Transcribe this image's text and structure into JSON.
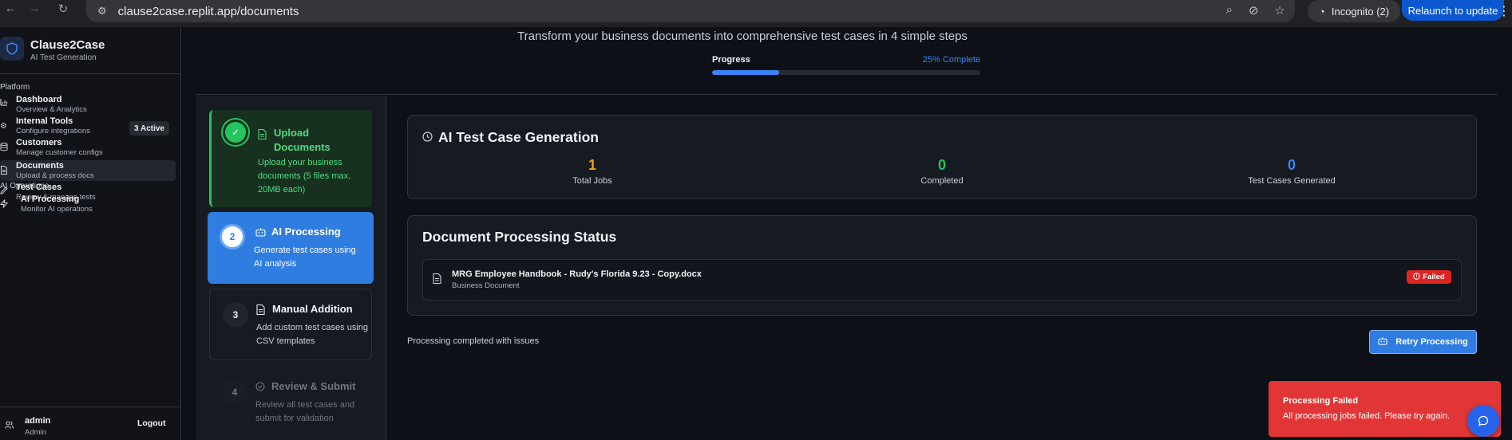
{
  "browser": {
    "url": "clause2case.replit.app/documents",
    "incognito_label": "Incognito (2)",
    "relaunch_label": "Relaunch to update"
  },
  "sidebar": {
    "brand_title": "Clause2Case",
    "brand_subtitle": "AI Test Generation",
    "section_platform": "Platform",
    "section_ai_ops": "AI Operations",
    "items": [
      {
        "title": "Dashboard",
        "subtitle": "Overview & Analytics",
        "icon": "bar-chart-icon"
      },
      {
        "title": "Internal Tools",
        "subtitle": "Configure integrations",
        "icon": "gear-icon",
        "badge": "3 Active"
      },
      {
        "title": "Customers",
        "subtitle": "Manage customer configs",
        "icon": "database-icon"
      },
      {
        "title": "Documents",
        "subtitle": "Upload & process docs",
        "icon": "file-icon",
        "active": true
      },
      {
        "title": "Test Cases",
        "subtitle": "Review & manage tests",
        "icon": "pencil-icon"
      }
    ],
    "ai_items": [
      {
        "title": "AI Processing",
        "subtitle": "Monitor AI operations",
        "icon": "bolt-icon"
      }
    ],
    "user": {
      "name": "admin",
      "role": "Admin"
    },
    "logout_label": "Logout"
  },
  "header": {
    "subtitle": "Transform your business documents into comprehensive test cases in 4 simple steps",
    "progress_label": "Progress",
    "progress_text": "25% Complete",
    "progress_value": 0.25,
    "accent_color": "#3b82f6"
  },
  "steps": [
    {
      "number": "✓",
      "title": "Upload Documents",
      "desc": "Upload your business documents (5 files max, 20MB each)",
      "state": "done"
    },
    {
      "number": "2",
      "title": "AI Processing",
      "desc": "Generate test cases using AI analysis",
      "state": "current"
    },
    {
      "number": "3",
      "title": "Manual Addition",
      "desc": "Add custom test cases using CSV templates",
      "state": "pending"
    },
    {
      "number": "4",
      "title": "Review & Submit",
      "desc": "Review all test cases and submit for validation",
      "state": "future"
    }
  ],
  "generation": {
    "title": "AI Test Case Generation",
    "stats": [
      {
        "value": "1",
        "label": "Total Jobs",
        "color": "#f59e0b"
      },
      {
        "value": "0",
        "label": "Completed",
        "color": "#22c55e"
      },
      {
        "value": "0",
        "label": "Test Cases Generated",
        "color": "#3b82f6"
      }
    ]
  },
  "processing": {
    "title": "Document Processing Status",
    "document": {
      "name": "MRG Employee Handbook - Rudy's Florida 9.23 - Copy.docx",
      "type": "Business Document",
      "status": "Failed"
    },
    "status_text": "Processing completed with issues",
    "retry_label": "Retry Processing"
  },
  "toast": {
    "title": "Processing Failed",
    "message": "All processing jobs failed. Please try again."
  }
}
